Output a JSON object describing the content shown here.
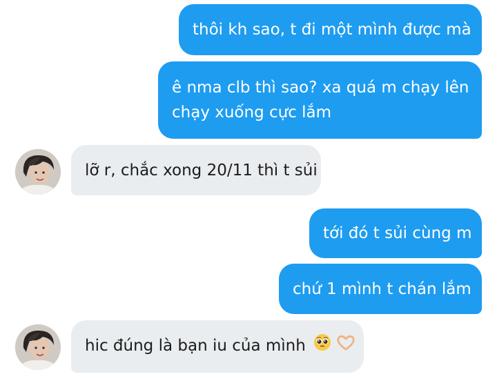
{
  "conversation": {
    "messages": [
      {
        "from": "me",
        "text": "thôi kh sao, t đi một mình được mà"
      },
      {
        "from": "me",
        "line1": "ê nma clb thì sao? xa quá m chạy lên",
        "line2": "chạy xuống cực lắm"
      },
      {
        "from": "friend",
        "text": "lỡ r, chắc xong 20/11 thì t sủi"
      },
      {
        "from": "me",
        "text": "tới đó t sủi cùng m"
      },
      {
        "from": "me",
        "text": "chứ 1 mình t chán lắm"
      },
      {
        "from": "friend",
        "text": "hic đúng là bạn iu của mình",
        "emojis": [
          "pleading-face-icon",
          "heart-hands-icon"
        ]
      }
    ]
  },
  "colors": {
    "sent_bubble": "#1e9cf0",
    "received_bubble": "#e9edf0",
    "sent_text": "#ffffff",
    "received_text": "#1c1c1c"
  }
}
